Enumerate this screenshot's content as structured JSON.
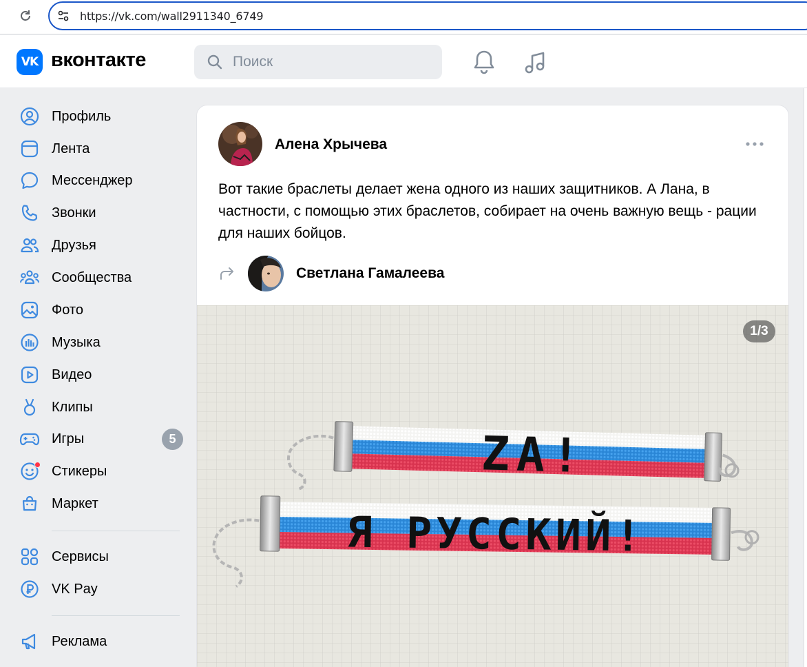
{
  "browser": {
    "url": "https://vk.com/wall2911340_6749"
  },
  "header": {
    "logo_mark": "VK",
    "logo_text": "вконтакте",
    "search_placeholder": "Поиск",
    "icons": [
      "notifications-bell-icon",
      "music-note-icon"
    ]
  },
  "sidebar": {
    "items": [
      {
        "label": "Профиль",
        "icon": "user-circle-icon"
      },
      {
        "label": "Лента",
        "icon": "newsfeed-icon"
      },
      {
        "label": "Мессенджер",
        "icon": "message-bubble-icon"
      },
      {
        "label": "Звонки",
        "icon": "phone-icon"
      },
      {
        "label": "Друзья",
        "icon": "friends-icon"
      },
      {
        "label": "Сообщества",
        "icon": "communities-icon"
      },
      {
        "label": "Фото",
        "icon": "photo-icon"
      },
      {
        "label": "Музыка",
        "icon": "music-icon"
      },
      {
        "label": "Видео",
        "icon": "video-icon"
      },
      {
        "label": "Клипы",
        "icon": "clips-icon"
      },
      {
        "label": "Игры",
        "icon": "gamepad-icon",
        "badge": "5"
      },
      {
        "label": "Стикеры",
        "icon": "smile-icon",
        "dot": true
      },
      {
        "label": "Маркет",
        "icon": "shopping-bag-icon"
      },
      {
        "label": "Сервисы",
        "icon": "grid-icon"
      },
      {
        "label": "VK Pay",
        "icon": "ruble-icon"
      },
      {
        "label": "Реклама",
        "icon": "megaphone-icon"
      }
    ]
  },
  "post": {
    "author": "Алена Хрычева",
    "text": "Вот такие браслеты делает жена одного из наших защитников. А Лана, в частности, с помощью этих браслетов, собирает на очень важную вещь - рации для наших бойцов.",
    "repost_author": "Светлана Гамалеева",
    "photo_counter": "1/3",
    "bracelet_1_text": "ZA!",
    "bracelet_2_text": "Я РУССКИЙ!"
  },
  "colors": {
    "accent": "#0077ff",
    "page_bg": "#edeef0",
    "icon": "#3f8ae0",
    "flag_white": "#f4f4f2",
    "flag_blue": "#2a86d6",
    "flag_red": "#d8334f"
  }
}
